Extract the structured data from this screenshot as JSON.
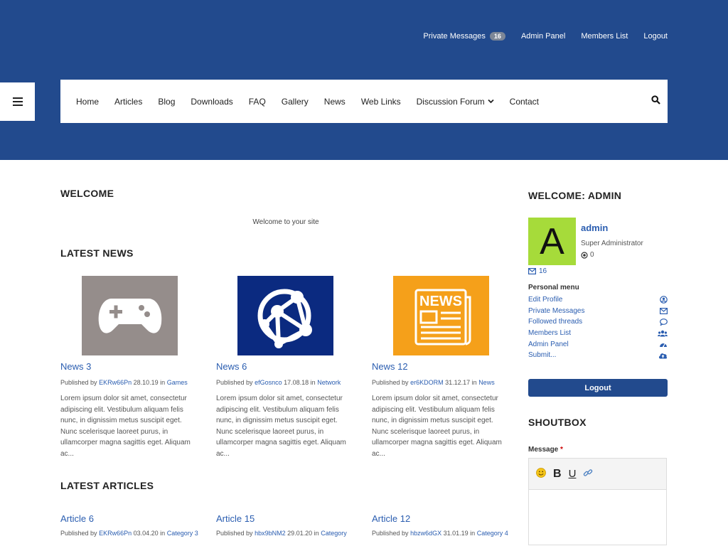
{
  "topnav": {
    "private_messages": "Private Messages",
    "pm_count": "16",
    "admin_panel": "Admin Panel",
    "members_list": "Members List",
    "logout": "Logout"
  },
  "mainnav": {
    "items": [
      "Home",
      "Articles",
      "Blog",
      "Downloads",
      "FAQ",
      "Gallery",
      "News",
      "Web Links",
      "Discussion Forum",
      "Contact"
    ]
  },
  "welcome": {
    "heading": "WELCOME",
    "text": "Welcome to your site"
  },
  "latest_news": {
    "heading": "LATEST NEWS",
    "items": [
      {
        "title": "News 3",
        "prefix": "Published by",
        "author": "EKRw66Pn",
        "date": "28.10.19",
        "in": "in",
        "category": "Games",
        "thumb_color": "#958d8b",
        "icon": "gamepad-icon",
        "body": "Lorem ipsum dolor sit amet, consectetur adipiscing elit. Vestibulum aliquam felis nunc, in dignissim metus suscipit eget. Nunc scelerisque laoreet purus, in ullamcorper magna sagittis eget. Aliquam ac..."
      },
      {
        "title": "News 6",
        "prefix": "Published by",
        "author": "efGosnco",
        "date": "17.08.18",
        "in": "in",
        "category": "Network",
        "thumb_color": "#0b2a80",
        "icon": "network-globe-icon",
        "body": "Lorem ipsum dolor sit amet, consectetur adipiscing elit. Vestibulum aliquam felis nunc, in dignissim metus suscipit eget. Nunc scelerisque laoreet purus, in ullamcorper magna sagittis eget. Aliquam ac..."
      },
      {
        "title": "News 12",
        "prefix": "Published by",
        "author": "er6KDORM",
        "date": "31.12.17",
        "in": "in",
        "category": "News",
        "thumb_color": "#f5a01a",
        "icon": "newspaper-icon",
        "body": "Lorem ipsum dolor sit amet, consectetur adipiscing elit. Vestibulum aliquam felis nunc, in dignissim metus suscipit eget. Nunc scelerisque laoreet purus, in ullamcorper magna sagittis eget. Aliquam ac..."
      }
    ]
  },
  "latest_articles": {
    "heading": "LATEST ARTICLES",
    "items": [
      {
        "title": "Article 6",
        "prefix": "Published by",
        "author": "EKRw66Pn",
        "date": "03.04.20",
        "in": "in",
        "category": "Category 3"
      },
      {
        "title": "Article 15",
        "prefix": "Published by",
        "author": "hbx9bNM2",
        "date": "29.01.20",
        "in": "in",
        "category": "Category"
      },
      {
        "title": "Article 12",
        "prefix": "Published by",
        "author": "hbzw6dGX",
        "date": "31.01.19",
        "in": "in",
        "category": "Category 4"
      }
    ]
  },
  "sidebar": {
    "welcome_heading": "WELCOME: ADMIN",
    "avatar_letter": "A",
    "avatar_color": "#a6db3a",
    "username": "admin",
    "role": "Super Administrator",
    "points": "0",
    "messages": "16",
    "personal_menu_label": "Personal menu",
    "menu": [
      {
        "label": "Edit Profile",
        "icon": "user-circle-icon"
      },
      {
        "label": "Private Messages",
        "icon": "envelope-icon"
      },
      {
        "label": "Followed threads",
        "icon": "comment-icon"
      },
      {
        "label": "Members List",
        "icon": "users-icon"
      },
      {
        "label": "Admin Panel",
        "icon": "dashboard-icon"
      },
      {
        "label": "Submit...",
        "icon": "cloud-upload-icon"
      }
    ],
    "logout_label": "Logout"
  },
  "shoutbox": {
    "heading": "SHOUTBOX",
    "message_label": "Message",
    "required_mark": "*",
    "toolbar": {
      "bold": "B",
      "underline": "U"
    }
  },
  "colors": {
    "brand": "#224a8d",
    "link": "#2a5db0"
  }
}
